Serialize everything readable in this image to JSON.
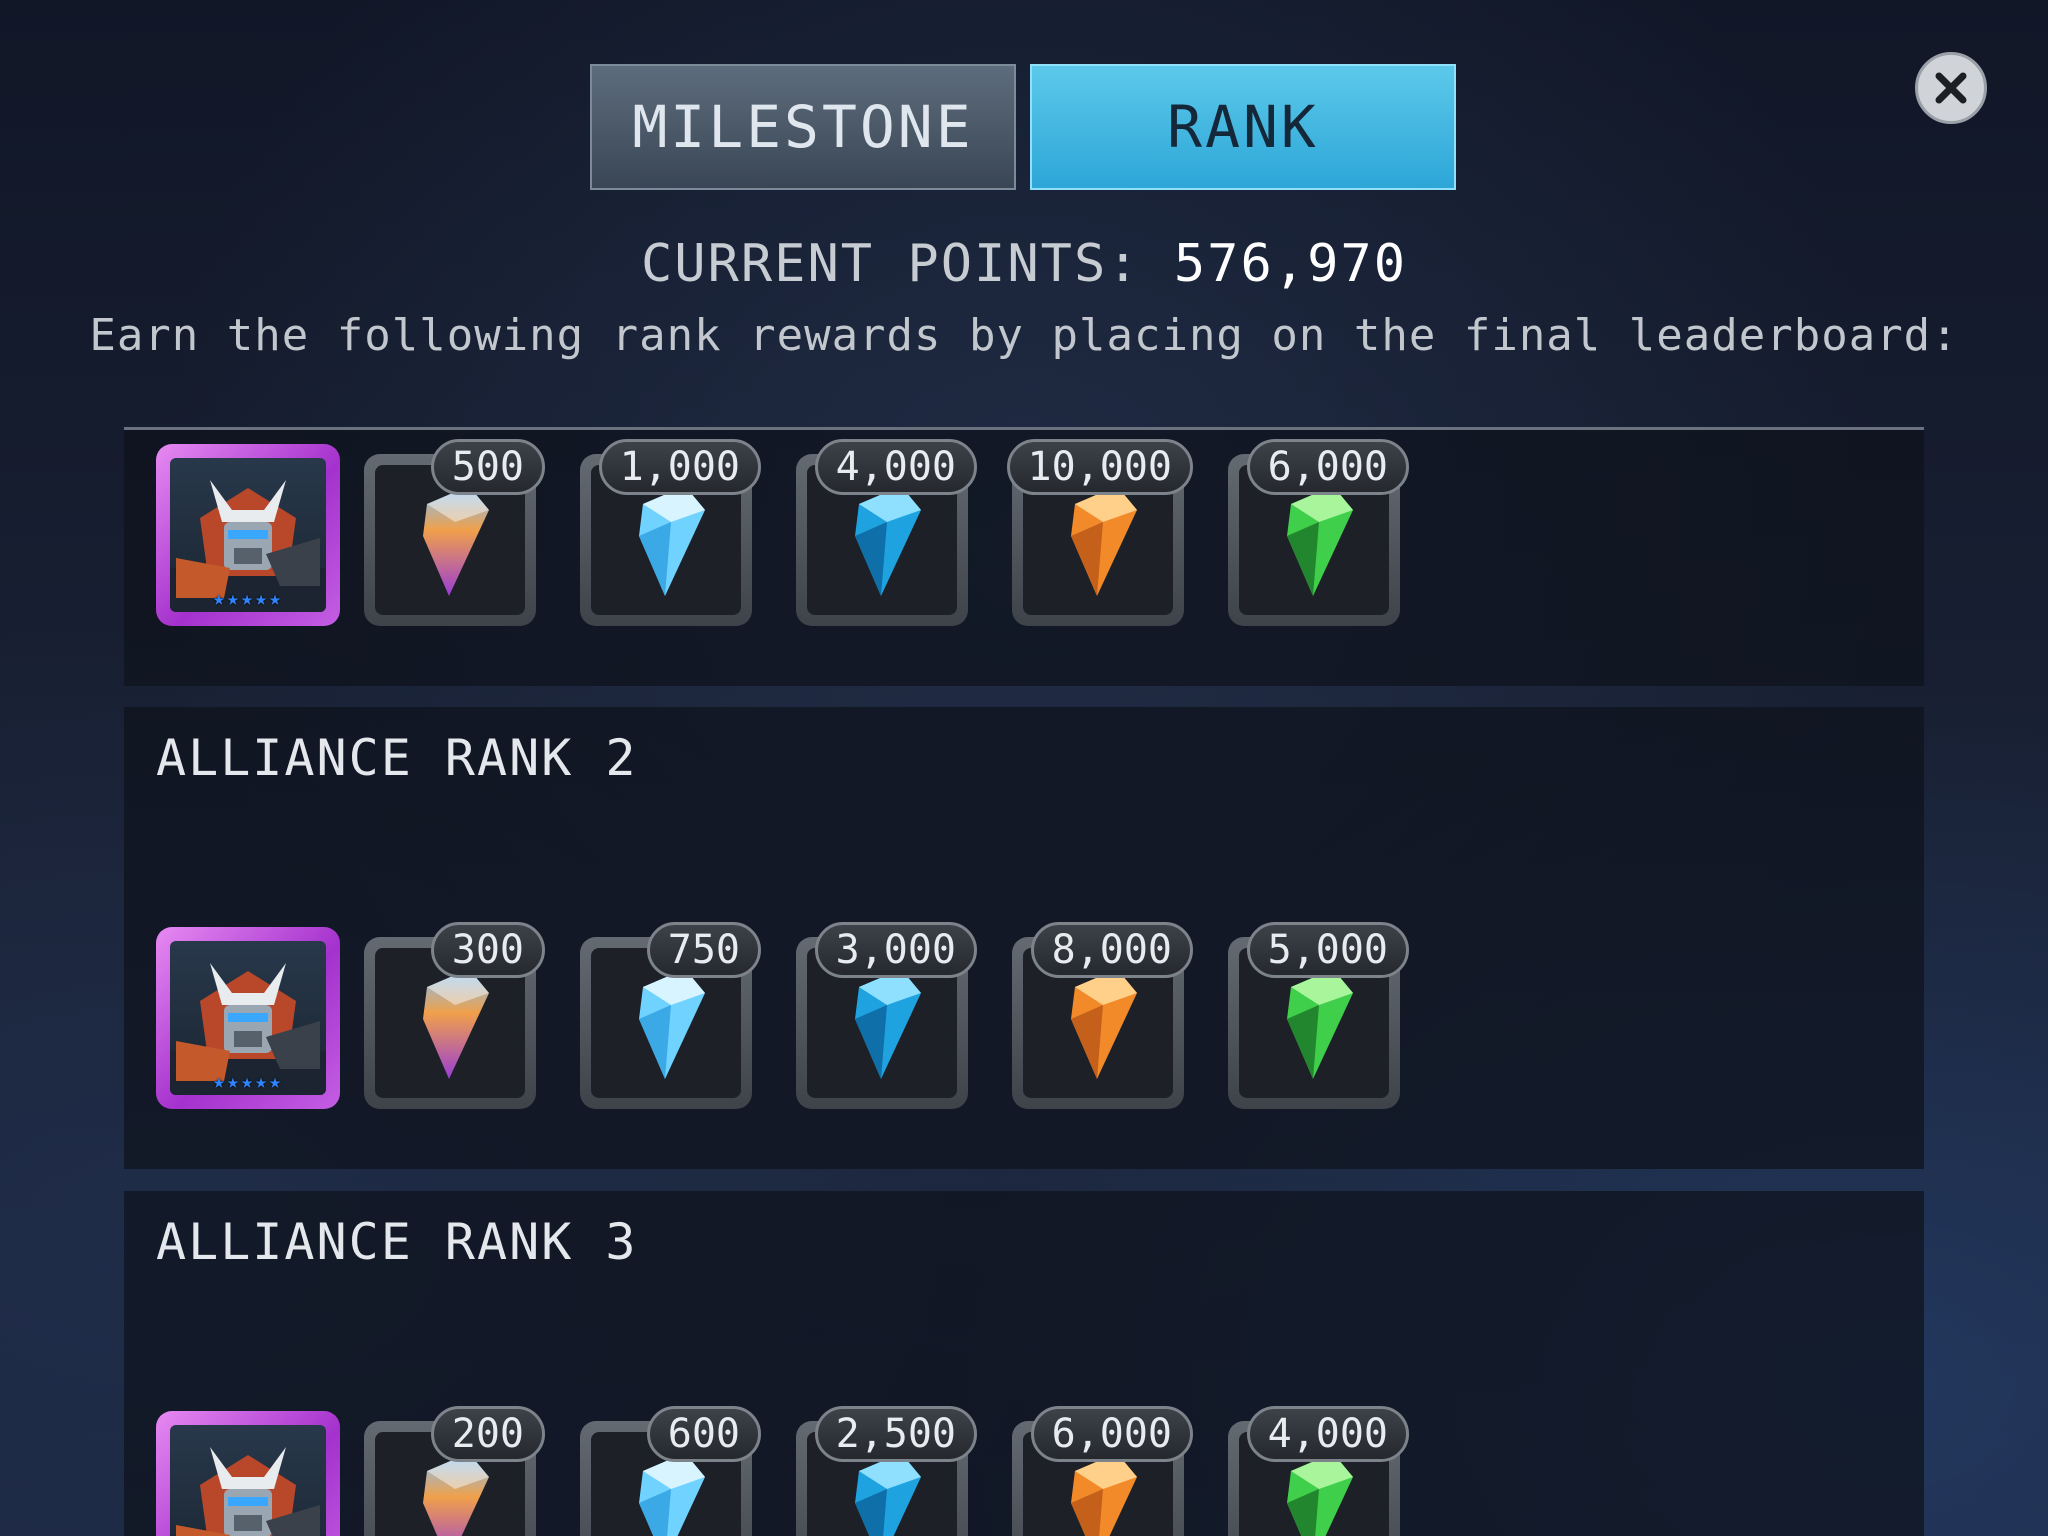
{
  "tabs": {
    "milestone": "MILESTONE",
    "rank": "RANK",
    "active": "rank"
  },
  "header": {
    "points_label": "CURRENT POINTS:",
    "points_value": "576,970",
    "subtitle": "Earn the following rank rewards by placing on the final leaderboard:"
  },
  "close_icon": "close-icon",
  "colors": {
    "tab_active": "#2da6d8",
    "tab_inactive": "#4a5666",
    "hero_frame": "#b83fd9",
    "star": "#2f84ff",
    "crystal_rainbow": "#b26ad6",
    "crystal_ice": "#7fd8ff",
    "crystal_blue": "#1fa3e0",
    "crystal_orange": "#f28a2a",
    "crystal_green": "#3fcf4a"
  },
  "ranks": [
    {
      "title": "",
      "hero_stars": "★★★★★",
      "rewards": [
        {
          "icon": "rainbow-crystal-icon",
          "amount": "500"
        },
        {
          "icon": "ice-crystal-icon",
          "amount": "1,000"
        },
        {
          "icon": "blue-crystal-icon",
          "amount": "4,000"
        },
        {
          "icon": "orange-crystal-icon",
          "amount": "10,000"
        },
        {
          "icon": "green-crystal-icon",
          "amount": "6,000"
        }
      ]
    },
    {
      "title": "ALLIANCE RANK 2",
      "hero_stars": "★★★★★",
      "rewards": [
        {
          "icon": "rainbow-crystal-icon",
          "amount": "300"
        },
        {
          "icon": "ice-crystal-icon",
          "amount": "750"
        },
        {
          "icon": "blue-crystal-icon",
          "amount": "3,000"
        },
        {
          "icon": "orange-crystal-icon",
          "amount": "8,000"
        },
        {
          "icon": "green-crystal-icon",
          "amount": "5,000"
        }
      ]
    },
    {
      "title": "ALLIANCE RANK 3",
      "hero_stars": "★★★★★",
      "rewards": [
        {
          "icon": "rainbow-crystal-icon",
          "amount": "200"
        },
        {
          "icon": "ice-crystal-icon",
          "amount": "600"
        },
        {
          "icon": "blue-crystal-icon",
          "amount": "2,500"
        },
        {
          "icon": "orange-crystal-icon",
          "amount": "6,000"
        },
        {
          "icon": "green-crystal-icon",
          "amount": "4,000"
        }
      ]
    }
  ]
}
